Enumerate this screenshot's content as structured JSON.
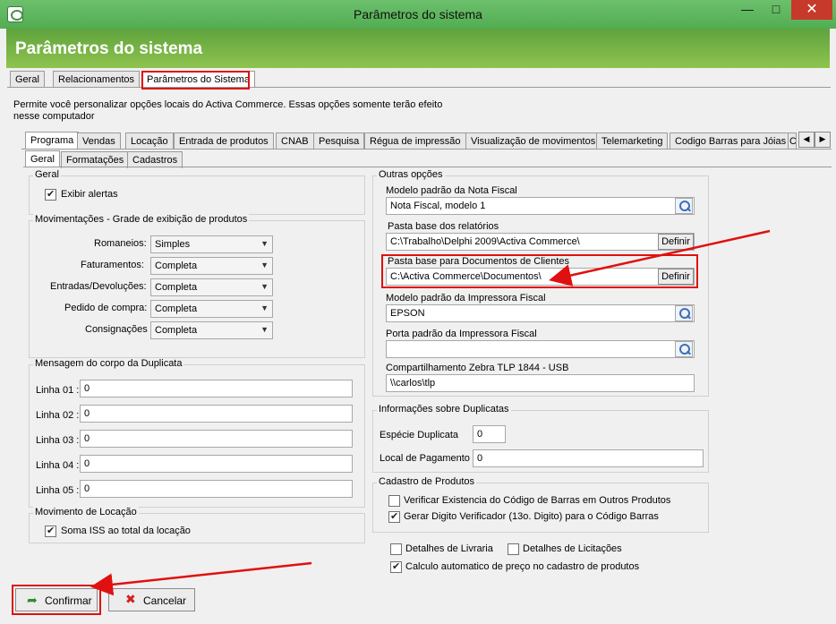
{
  "window": {
    "title": "Parâmetros do sistema",
    "minimize": "—",
    "maximize": "□",
    "close": "✕"
  },
  "header": {
    "title": "Parâmetros do sistema"
  },
  "top_tabs": [
    "Geral",
    "Relacionamentos",
    "Parâmetros do Sistema"
  ],
  "description_line1": "Permite você personalizar opções locais do Activa Commerce. Essas opções somente terão efeito",
  "description_line2": "nesse computador",
  "section_tabs": [
    "Programa",
    "Vendas",
    "Locação",
    "Entrada de produtos",
    "CNAB",
    "Pesquisa",
    "Régua de impressão",
    "Visualização de movimentos",
    "Telemarketing",
    "Codigo Barras para Jóias",
    "C"
  ],
  "sub_tabs": [
    "Geral",
    "Formatações",
    "Cadastros"
  ],
  "geral": {
    "title": "Geral",
    "exibir_alertas": "Exibir alertas"
  },
  "movimentacoes": {
    "title": "Movimentações - Grade de exibição de produtos",
    "rows": [
      {
        "label": "Romaneios:",
        "value": "Simples"
      },
      {
        "label": "Faturamentos:",
        "value": "Completa"
      },
      {
        "label": "Entradas/Devoluções:",
        "value": "Completa"
      },
      {
        "label": "Pedido de compra:",
        "value": "Completa"
      },
      {
        "label": "Consignações",
        "value": "Completa"
      }
    ]
  },
  "mensagem": {
    "title": "Mensagem do corpo da Duplicata",
    "lines": [
      {
        "label": "Linha 01 :",
        "value": "0"
      },
      {
        "label": "Linha 02 :",
        "value": "0"
      },
      {
        "label": "Linha 03 :",
        "value": "0"
      },
      {
        "label": "Linha 04 :",
        "value": "0"
      },
      {
        "label": "Linha 05 :",
        "value": "0"
      }
    ]
  },
  "locacao": {
    "title": "Movimento de Locação",
    "soma_iss": "Soma ISS ao total da locação"
  },
  "outras": {
    "title": "Outras opções",
    "modelo_nf_label": "Modelo padrão da Nota Fiscal",
    "modelo_nf_value": "Nota Fiscal, modelo 1",
    "pasta_relatorios_label": "Pasta base dos relatórios",
    "pasta_relatorios_value": "C:\\Trabalho\\Delphi 2009\\Activa Commerce\\",
    "pasta_docs_label": "Pasta base para Documentos de Clientes",
    "pasta_docs_value": "C:\\Activa Commerce\\Documentos\\",
    "definir": "Definir",
    "impressora_label": "Modelo padrão da Impressora Fiscal",
    "impressora_value": "EPSON",
    "porta_label": "Porta padrão da Impressora Fiscal",
    "porta_value": "",
    "zebra_label": "Compartilhamento Zebra TLP 1844 - USB",
    "zebra_value": "\\\\carlos\\tlp"
  },
  "duplicatas": {
    "title": "Informações sobre Duplicatas",
    "especie_label": "Espécie Duplicata",
    "especie_value": "0",
    "local_label": "Local de Pagamento",
    "local_value": "0"
  },
  "cadastro": {
    "title": "Cadastro de Produtos",
    "verificar": "Verificar Existencia do Código de Barras em Outros Produtos",
    "gerar": "Gerar Digito Verificador (13o. Digito) para o Código Barras"
  },
  "extras": {
    "livraria": "Detalhes de Livraria",
    "licitacoes": "Detalhes de Licitações",
    "calculo": "Calculo automatico de preço no cadastro de produtos"
  },
  "buttons": {
    "confirmar": "Confirmar",
    "cancelar": "Cancelar"
  },
  "colors": {
    "annotation_red": "#e01010",
    "header_green": "#6aaa42",
    "titlebar_green": "#5cb85c"
  }
}
